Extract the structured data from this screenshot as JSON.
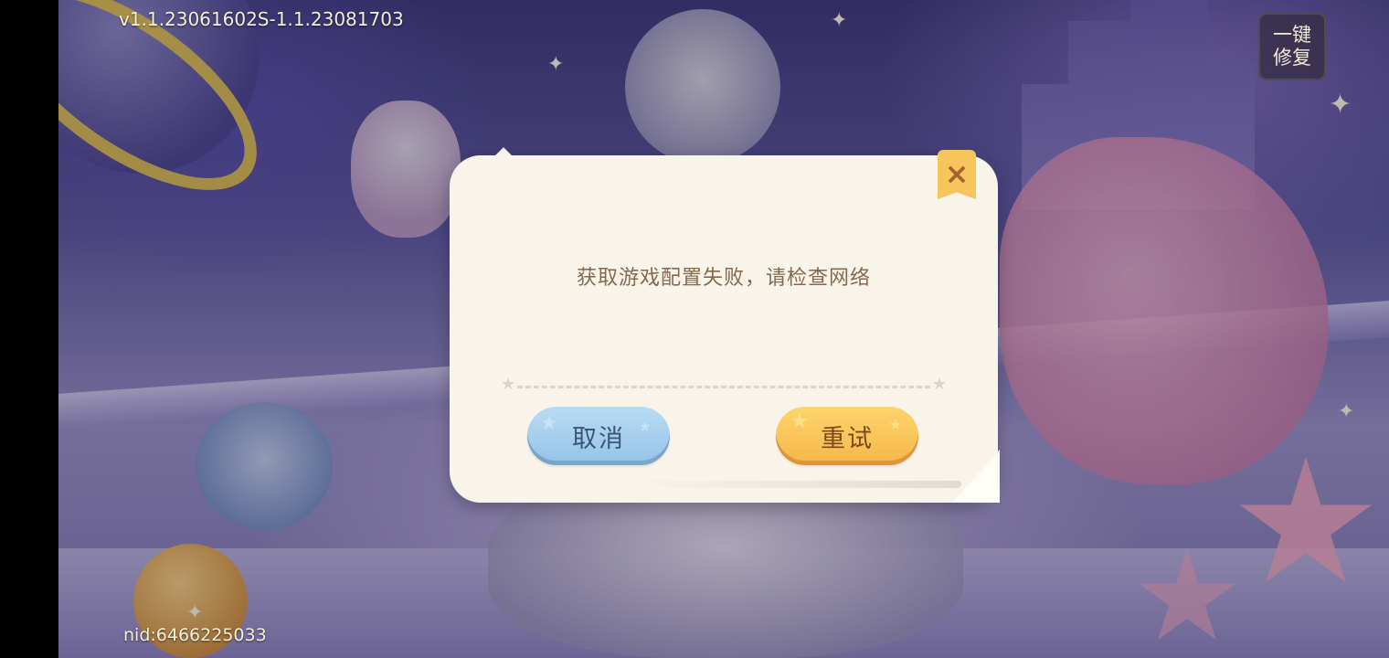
{
  "hud": {
    "version": "v1.1.23061602S-1.1.23081703",
    "nid": "nid:6466225033",
    "repair_button": {
      "line1": "一键",
      "line2": "修复"
    }
  },
  "dialog": {
    "message": "获取游戏配置失败，请检查网络",
    "close_icon": "×",
    "cancel_label": "取消",
    "retry_label": "重试"
  },
  "colors": {
    "dialog_bg": "#f8f4ea",
    "message_text": "#85684e",
    "cancel_button": "#a8d2ef",
    "retry_button": "#f9c85a",
    "close_tab": "#f6c65d"
  },
  "icons": {
    "close": "close-icon",
    "divider_star": "star-icon"
  }
}
